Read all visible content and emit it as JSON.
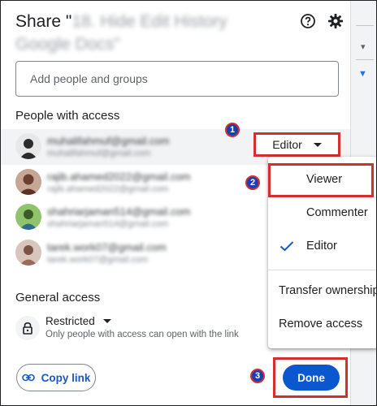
{
  "dialog": {
    "title_prefix": "Share \"",
    "title_doc": "18. Hide Edit History Google Docs\"",
    "help_icon": "help-circle-icon",
    "settings_icon": "gear-icon"
  },
  "add_people": {
    "placeholder": "Add people and groups"
  },
  "people_section": {
    "label": "People with access",
    "people": [
      {
        "name": "muhalifahmuf@gmail.com",
        "email": "muhalifahmuf@gmail.com",
        "avatar_color": "#3a3a3a"
      },
      {
        "name": "rajib.ahamed2022@gmail.com",
        "email": "rajib.ahamed2022@gmail.com",
        "avatar_color": "#8d5a4a"
      },
      {
        "name": "shahriarjaman514@gmail.com",
        "email": "shahriarjaman514@gmail.com",
        "avatar_color": "#6aa84f"
      },
      {
        "name": "tarek.work07@gmail.com",
        "email": "tarek.work07@gmail.com",
        "avatar_color": "#b08a7a"
      }
    ]
  },
  "role_button": {
    "label": "Editor"
  },
  "role_menu": {
    "items": [
      {
        "label": "Viewer",
        "checked": false
      },
      {
        "label": "Commenter",
        "checked": false
      },
      {
        "label": "Editor",
        "checked": true
      },
      {
        "label": "Transfer ownership"
      },
      {
        "label": "Remove access"
      }
    ]
  },
  "general_access": {
    "title": "General access",
    "mode": "Restricted",
    "description": "Only people with access can open with the link"
  },
  "footer": {
    "copy_link": "Copy link",
    "done": "Done"
  },
  "badges": {
    "step1": "1",
    "step2": "2",
    "step3": "3"
  },
  "colors": {
    "accent": "#0b57d0",
    "highlight": "#d32f2f",
    "badge": "#1a3fb0"
  }
}
